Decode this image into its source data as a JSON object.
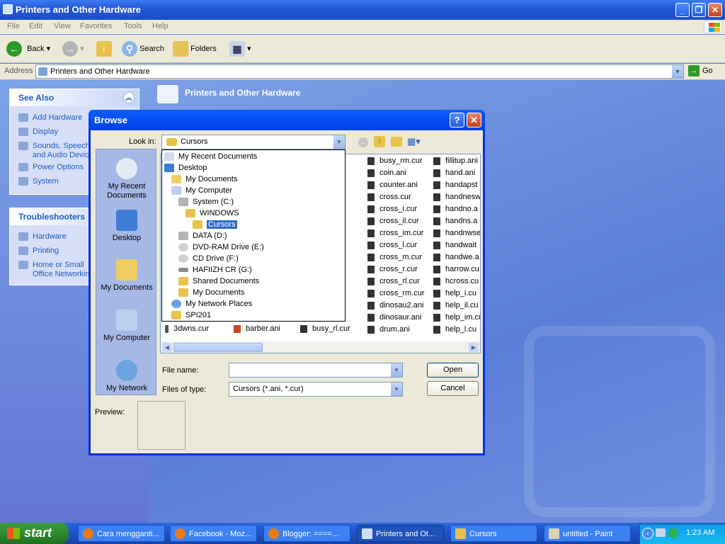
{
  "window": {
    "title": "Printers and Other Hardware"
  },
  "menu": [
    "File",
    "Edit",
    "View",
    "Favorites",
    "Tools",
    "Help"
  ],
  "toolbar": {
    "back": "Back",
    "search": "Search",
    "folders": "Folders"
  },
  "address": {
    "label": "Address",
    "value": "Printers and Other Hardware",
    "go": "Go"
  },
  "see_also": {
    "title": "See Also",
    "items": [
      "Add Hardware",
      "Display",
      "Sounds, Speech, and Audio Devices",
      "Power Options",
      "System"
    ]
  },
  "troubleshooters": {
    "title": "Troubleshooters",
    "items": [
      "Hardware",
      "Printing",
      "Home or Small Office Networking"
    ]
  },
  "main_header": "Printers and Other Hardware",
  "dialog": {
    "title": "Browse",
    "look_in_label": "Look in:",
    "look_in_value": "Cursors",
    "places": [
      "My Recent Documents",
      "Desktop",
      "My Documents",
      "My Computer",
      "My Network"
    ],
    "file_name_label": "File name:",
    "file_name_value": "",
    "file_type_label": "Files of type:",
    "file_type_value": "Cursors (*.ani, *.cur)",
    "open": "Open",
    "cancel": "Cancel",
    "preview_label": "Preview:"
  },
  "files": {
    "col1": [
      "3dwns.cur"
    ],
    "col2": [
      "barber.ani"
    ],
    "col3": [
      "busy_rl.cur"
    ],
    "col4": [
      "busy_rm.cur",
      "coin.ani",
      "counter.ani",
      "cross.cur",
      "cross_i.cur",
      "cross_il.cur",
      "cross_im.cur",
      "cross_l.cur",
      "cross_m.cur",
      "cross_r.cur",
      "cross_rl.cur",
      "cross_rm.cur",
      "dinosau2.ani",
      "dinosaur.ani",
      "drum.ani"
    ],
    "col5": [
      "fillitup.ani",
      "hand.ani",
      "handapst",
      "handnesw",
      "handno.a",
      "handns.a",
      "handnwse",
      "handwait",
      "handwe.a",
      "harrow.cu",
      "hcross.cu",
      "help_i.cu",
      "help_il.cu",
      "help_im.cu",
      "help_l.cu"
    ]
  },
  "lookin_dropdown": [
    "My Recent Documents",
    "Desktop",
    "My Documents",
    "My Computer",
    "System (C:)",
    "WINDOWS",
    "Cursors",
    "DATA (D:)",
    "DVD-RAM Drive (E:)",
    "CD Drive (F:)",
    "HAFIIZH CR (G:)",
    "Shared Documents",
    "My Documents",
    "My Network Places",
    "SPI201"
  ],
  "taskbar": {
    "start": "start",
    "tasks": [
      "Cara mengganti...",
      "Facebook - Moz...",
      "Blogger: ====...",
      "Printers and Ot...",
      "Cursors",
      "untitled - Paint"
    ],
    "clock": "1:23 AM"
  }
}
